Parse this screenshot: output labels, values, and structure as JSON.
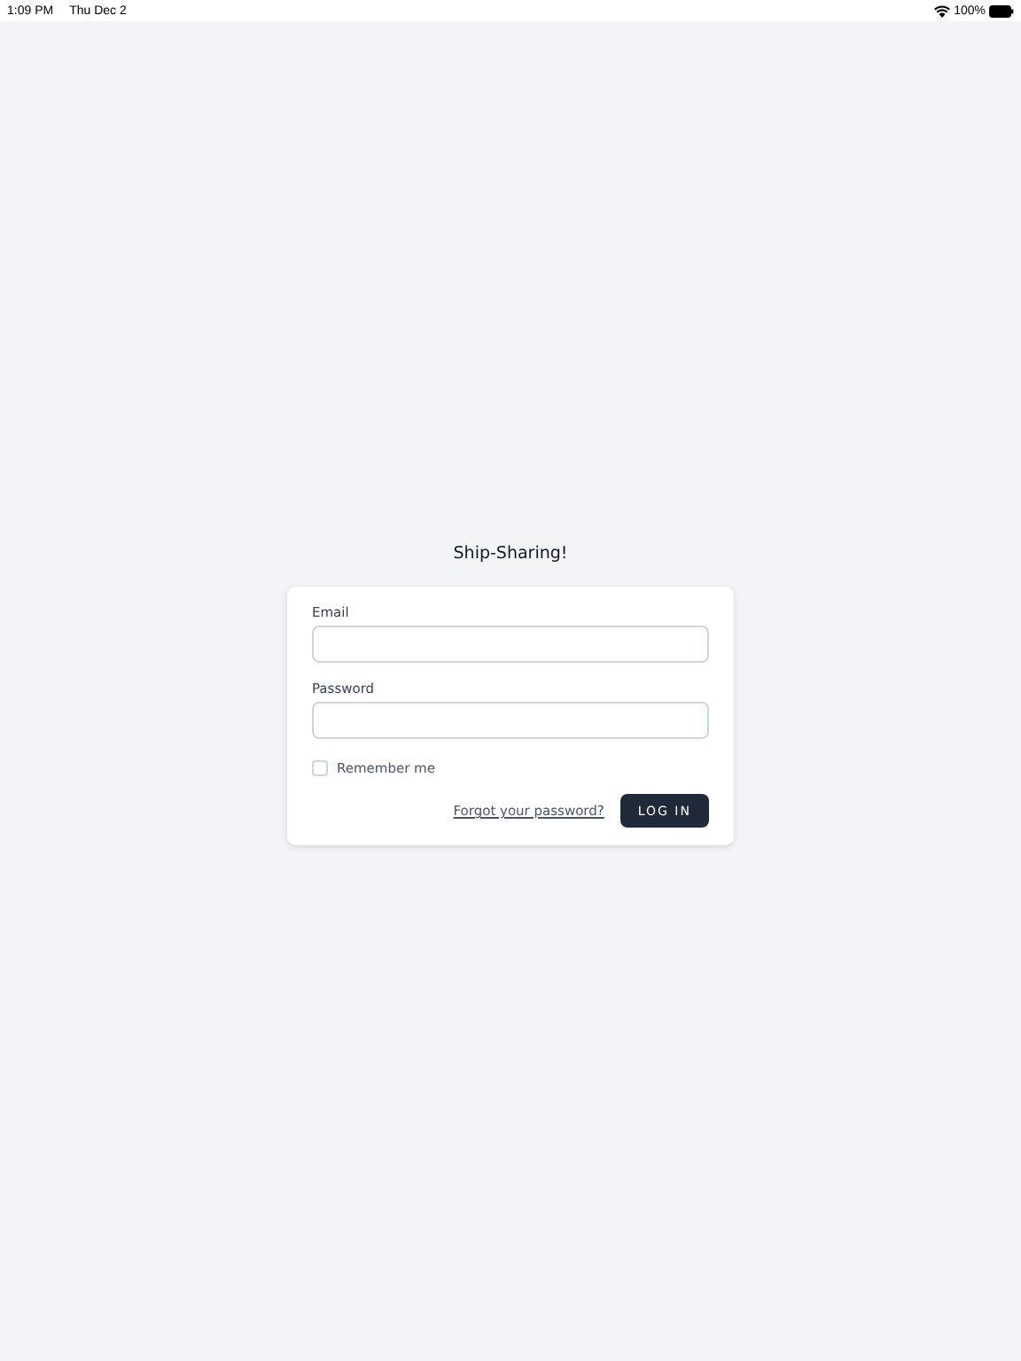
{
  "status_bar": {
    "time": "1:09 PM",
    "date": "Thu Dec 2",
    "battery": "100%"
  },
  "title": "Ship-Sharing!",
  "form": {
    "fields": [
      {
        "label": "Email"
      },
      {
        "label": "Password"
      }
    ],
    "remember": {
      "label": "Remember me",
      "checked": false
    },
    "forgot_link": "Forgot your password?",
    "submit": "LOG IN"
  }
}
